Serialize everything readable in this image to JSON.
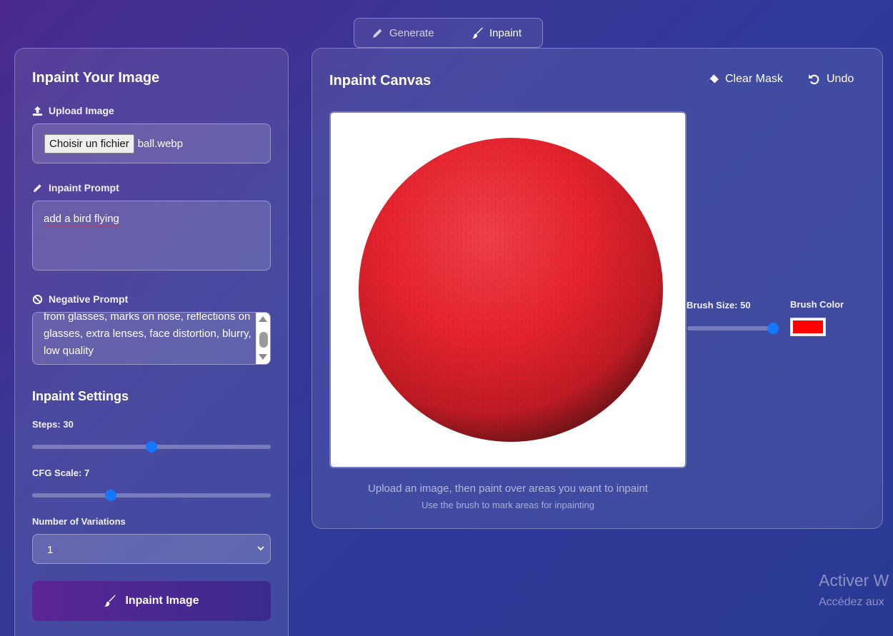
{
  "tabs": [
    {
      "label": "Generate",
      "icon": "pencil-icon",
      "active": false
    },
    {
      "label": "Inpaint",
      "icon": "paintbrush-icon",
      "active": true
    }
  ],
  "left": {
    "title": "Inpaint Your Image",
    "upload_label": "Upload Image",
    "file_button": "Choisir un fichier",
    "file_name": "ball.webp",
    "prompt_label": "Inpaint Prompt",
    "prompt_value": "add a bird flying",
    "negative_label": "Negative Prompt",
    "negative_value": "from glasses, marks on nose, reflections on glasses, extra lenses, face distortion, blurry, low quality",
    "settings_title": "Inpaint Settings",
    "steps_label": "Steps: 30",
    "steps_value": 30,
    "steps_fraction": 0.5,
    "cfg_label": "CFG Scale: 7",
    "cfg_value": 7,
    "cfg_fraction": 0.32,
    "variations_label": "Number of Variations",
    "variations_value": "1",
    "action_label": "Inpaint Image"
  },
  "right": {
    "title": "Inpaint Canvas",
    "clear_label": "Clear Mask",
    "undo_label": "Undo",
    "brush_size_label": "Brush Size: 50",
    "brush_size_value": 50,
    "brush_color_label": "Brush Color",
    "brush_color": "#ff0000",
    "hint_main": "Upload an image, then paint over areas you want to inpaint",
    "hint_sub": "Use the brush to mark areas for inpainting"
  },
  "watermark": {
    "line1": "Activer W",
    "line2": "Accédez aux"
  },
  "colors": {
    "accent": "#1677ff",
    "ball": "#e8242f"
  }
}
